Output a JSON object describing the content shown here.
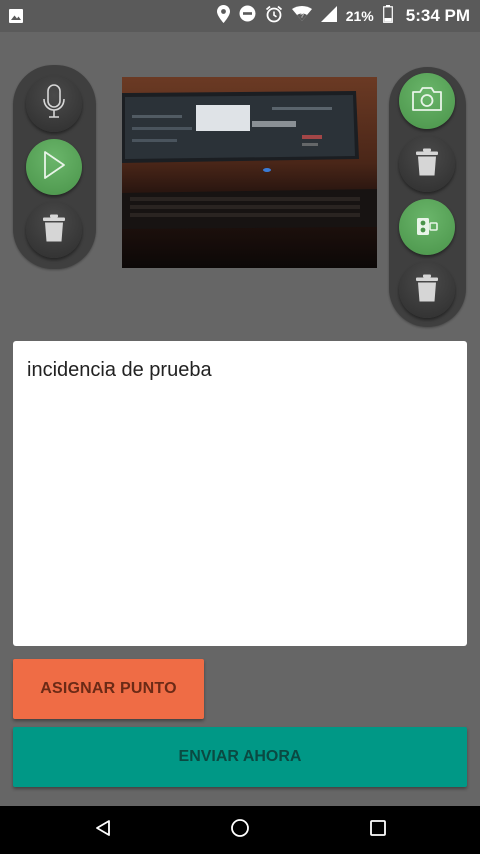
{
  "status_bar": {
    "battery_percent": "21%",
    "time": "5:34 PM",
    "icons": [
      "gallery-icon",
      "location-icon",
      "do-not-disturb-icon",
      "alarm-icon",
      "wifi-icon",
      "signal-icon",
      "battery-icon"
    ]
  },
  "left_controls": {
    "items": [
      {
        "icon": "microphone-icon",
        "style": "dark"
      },
      {
        "icon": "play-icon",
        "style": "green"
      },
      {
        "icon": "trash-icon",
        "style": "dark"
      }
    ]
  },
  "right_controls": {
    "items": [
      {
        "icon": "camera-icon",
        "style": "green"
      },
      {
        "icon": "trash-icon",
        "style": "dark"
      },
      {
        "icon": "video-camera-icon",
        "style": "green"
      },
      {
        "icon": "trash-icon",
        "style": "dark"
      }
    ]
  },
  "description": {
    "value": "incidencia de prueba"
  },
  "actions": {
    "assign_point_label": "ASIGNAR PUNTO",
    "send_now_label": "ENVIAR AHORA"
  },
  "colors": {
    "background": "#666666",
    "green_button": "#5aa35a",
    "assign_button": "#ef6c45",
    "send_button": "#009886"
  },
  "nav_bar": {
    "icons": [
      "back-icon",
      "home-icon",
      "recents-icon"
    ]
  }
}
